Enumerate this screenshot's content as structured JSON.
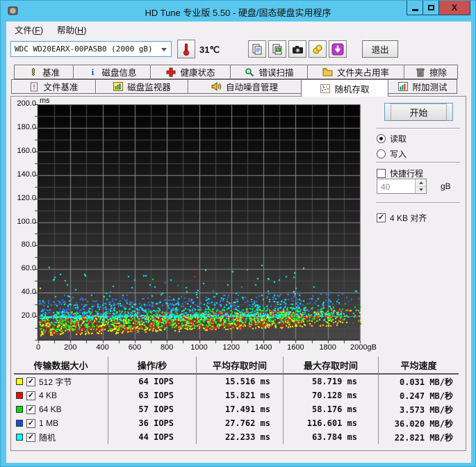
{
  "window": {
    "title": "HD Tune 专业版 5.50 - 硬盘/固态硬盘实用程序"
  },
  "menu": {
    "items": [
      {
        "pre": "文件(",
        "key": "F",
        "post": ")"
      },
      {
        "pre": "帮助(",
        "key": "H",
        "post": ")"
      }
    ]
  },
  "toolbar": {
    "drive_selected": "WDC WD20EARX-00PASB0 (2000 gB)",
    "temperature": "31℃",
    "button_icons": [
      "copy-text-icon",
      "copy-image-icon",
      "camera-icon",
      "save-icon",
      "download-icon"
    ],
    "exit_label": "退出"
  },
  "tabs": {
    "row1": [
      {
        "id": "benchmark",
        "label": "基准",
        "icon": "benchmark-icon"
      },
      {
        "id": "disk-info",
        "label": "磁盘信息",
        "icon": "disk-info-icon"
      },
      {
        "id": "health",
        "label": "健康状态",
        "icon": "health-icon"
      },
      {
        "id": "error-scan",
        "label": "错误扫描",
        "icon": "error-scan-icon"
      },
      {
        "id": "folder-usage",
        "label": "文件夹占用率",
        "icon": "folder-usage-icon"
      },
      {
        "id": "erase",
        "label": "擦除",
        "icon": "erase-icon"
      }
    ],
    "row2": [
      {
        "id": "file-benchmark",
        "label": "文件基准",
        "icon": "file-benchmark-icon"
      },
      {
        "id": "disk-monitor",
        "label": "磁盘监视器",
        "icon": "disk-monitor-icon"
      },
      {
        "id": "aam",
        "label": "自动噪音管理",
        "icon": "aam-icon"
      },
      {
        "id": "random-access",
        "label": "随机存取",
        "icon": "random-access-icon",
        "selected": true
      },
      {
        "id": "extra-tests",
        "label": "附加测试",
        "icon": "extra-tests-icon"
      }
    ],
    "selected": "随机存取"
  },
  "controls": {
    "start_label": "开始",
    "read_label": "读取",
    "write_label": "写入",
    "read_selected": true,
    "short_stroke_label": "快捷行程",
    "short_stroke_checked": false,
    "short_stroke_value": "40",
    "short_stroke_unit": "gB",
    "align_label": "4 KB 对齐",
    "align_checked": true
  },
  "chart_data": {
    "type": "scatter",
    "ylabel": "ms",
    "xlim": [
      0,
      2000
    ],
    "ylim": [
      0,
      200
    ],
    "x_minor_step": 100,
    "x_major_step": 200,
    "y_minor_step": 10,
    "y_major_step": 20,
    "grid": true,
    "background_gradient": [
      "#030303",
      "#474747"
    ],
    "grid_major_color": "#8c8c8c",
    "grid_minor_color": "#4c4c4c",
    "y_ticks": [
      {
        "v": 200,
        "label": "200.0"
      },
      {
        "v": 180,
        "label": "180.0"
      },
      {
        "v": 160,
        "label": "160.0"
      },
      {
        "v": 140,
        "label": "140.0"
      },
      {
        "v": 120,
        "label": "120.0"
      },
      {
        "v": 100,
        "label": "100.0"
      },
      {
        "v": 80,
        "label": "80.0"
      },
      {
        "v": 60,
        "label": "60.0"
      },
      {
        "v": 40,
        "label": "40.0"
      },
      {
        "v": 20,
        "label": "20.0"
      }
    ],
    "x_ticks": [
      {
        "v": 0,
        "label": "0"
      },
      {
        "v": 200,
        "label": "200"
      },
      {
        "v": 400,
        "label": "400"
      },
      {
        "v": 600,
        "label": "600"
      },
      {
        "v": 800,
        "label": "800"
      },
      {
        "v": 1000,
        "label": "1000"
      },
      {
        "v": 1200,
        "label": "1200"
      },
      {
        "v": 1400,
        "label": "1400"
      },
      {
        "v": 1600,
        "label": "1600"
      },
      {
        "v": 1800,
        "label": "1800"
      },
      {
        "v": 2000,
        "label": "2000gB"
      }
    ],
    "series": [
      {
        "name": "512 字节",
        "color": "#ffff00",
        "iops": 64,
        "avg_ms": 15.516,
        "max_ms": 58.719,
        "count": 900,
        "low": [
          4,
          9
        ],
        "high": [
          20,
          6
        ],
        "tail_p": 0.004,
        "tail_max": 58
      },
      {
        "name": "4 KB",
        "color": "#ff1c1c",
        "iops": 63,
        "avg_ms": 15.821,
        "max_ms": 70.128,
        "count": 850,
        "low": [
          5,
          9
        ],
        "high": [
          22,
          5
        ],
        "tail_p": 0.003,
        "tail_max": 70
      },
      {
        "name": "64 KB",
        "color": "#16ff16",
        "iops": 57,
        "avg_ms": 17.491,
        "max_ms": 58.176,
        "count": 850,
        "low": [
          7,
          9
        ],
        "high": [
          24,
          5
        ],
        "tail_p": 0.004,
        "tail_max": 58
      },
      {
        "name": "1 MB",
        "color": "#2e7dff",
        "iops": 36,
        "avg_ms": 27.762,
        "max_ms": 116.601,
        "count": 520,
        "low": [
          19,
          3
        ],
        "high": [
          34,
          8
        ],
        "tail_p": 0.03,
        "tail_max": 50
      },
      {
        "name": "随机",
        "color": "#00ffff",
        "iops": 44,
        "avg_ms": 22.233,
        "max_ms": 63.784,
        "count": 780,
        "low": [
          14,
          3
        ],
        "high": [
          30,
          6
        ],
        "tail_p": 0.12,
        "tail_max": 64,
        "cluster": [
          20,
          1.3,
          0.45
        ]
      }
    ]
  },
  "table": {
    "headers": [
      "传输数据大小",
      "操作/秒",
      "平均存取时间",
      "最大存取时间",
      "平均速度"
    ],
    "rows": [
      {
        "color": "#ffff00",
        "checked": true,
        "label": "512 字节",
        "ops": "64 IOPS",
        "avg": "15.516 ms",
        "max": "58.719 ms",
        "speed": "0.031 MB/秒"
      },
      {
        "color": "#ff0000",
        "checked": true,
        "label": "4 KB",
        "ops": "63 IOPS",
        "avg": "15.821 ms",
        "max": "70.128 ms",
        "speed": "0.247 MB/秒"
      },
      {
        "color": "#00dd00",
        "checked": true,
        "label": "64 KB",
        "ops": "57 IOPS",
        "avg": "17.491 ms",
        "max": "58.176 ms",
        "speed": "3.573 MB/秒"
      },
      {
        "color": "#1050d8",
        "checked": true,
        "label": "1 MB",
        "ops": "36 IOPS",
        "avg": "27.762 ms",
        "max": "116.601 ms",
        "speed": "36.020 MB/秒"
      },
      {
        "color": "#00ffff",
        "checked": true,
        "label": "随机",
        "ops": "44 IOPS",
        "avg": "22.233 ms",
        "max": "63.784 ms",
        "speed": "22.821 MB/秒"
      }
    ]
  }
}
